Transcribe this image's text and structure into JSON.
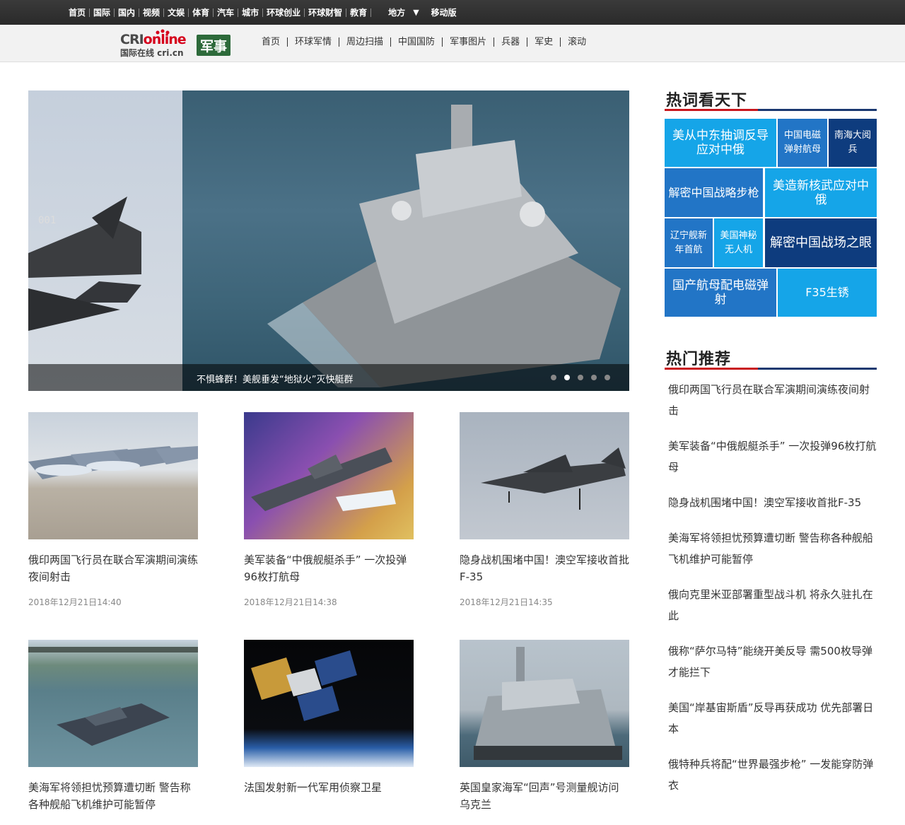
{
  "topnav": [
    "首页",
    "国际",
    "国内",
    "视频",
    "文娱",
    "体育",
    "汽车",
    "城市",
    "环球创业",
    "环球财智",
    "教育"
  ],
  "topnav_more": "地方",
  "topnav_arrow": "▼",
  "topnav_mobile": "移动版",
  "logo": {
    "brand": "CRI",
    "brand_suffix": "online",
    "sub": "国际在线 cri.cn",
    "channel": "军事"
  },
  "channav": [
    "首页",
    "环球军情",
    "周边扫描",
    "中国国防",
    "军事图片",
    "兵器",
    "军史",
    "滚动"
  ],
  "slider": {
    "caption": "不惧蜂群！美舰垂发“地狱火”灭快艇群",
    "dots": 5,
    "active_dot": 1
  },
  "cards": [
    {
      "title": "俄印两国飞行员在联合军演期间演练夜间射击",
      "date": "2018年12月21日14:40"
    },
    {
      "title": "美军装备“中俄舰艇杀手” 一次投弹96枚打航母",
      "date": "2018年12月21日14:38"
    },
    {
      "title": "隐身战机围堵中国！澳空军接收首批F-35",
      "date": "2018年12月21日14:35"
    },
    {
      "title": "美海军将领担忧预算遭切断 警告称各种舰船飞机维护可能暂停",
      "date": ""
    },
    {
      "title": "法国发射新一代军用侦察卫星",
      "date": ""
    },
    {
      "title": "英国皇家海军“回声”号测量舰访问乌克兰",
      "date": ""
    }
  ],
  "hotwords_title": "热词看天下",
  "hotwords": [
    "美从中东抽调反导应对中俄",
    "中国电磁弹射航母",
    "南海大阅兵",
    "解密中国战略步枪",
    "美造新核武应对中俄",
    "辽宁舰新年首航",
    "美国神秘无人机",
    "解密中国战场之眼",
    "国产航母配电磁弹射",
    "F35生锈"
  ],
  "hotrec_title": "热门推荐",
  "hotrec": [
    "俄印两国飞行员在联合军演期间演练夜间射击",
    "美军装备“中俄舰艇杀手” 一次投弹96枚打航母",
    "隐身战机围堵中国！澳空军接收首批F-35",
    "美海军将领担忧预算遭切断 警告称各种舰船飞机维护可能暂停",
    "俄向克里米亚部署重型战斗机 将永久驻扎在此",
    "俄称“萨尔马特”能绕开美反导 需500枚导弹才能拦下",
    "美国“岸基宙斯盾”反导再获成功 优先部署日本",
    "俄特种兵将配“世界最强步枪” 一发能穿防弹衣"
  ]
}
